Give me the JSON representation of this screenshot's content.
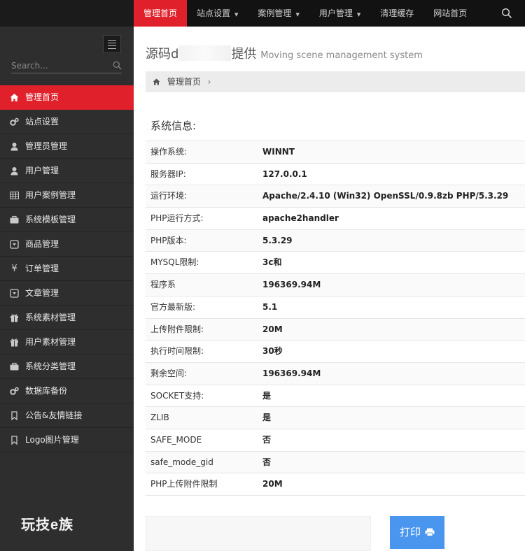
{
  "topnav": {
    "items": [
      {
        "label": "管理首页",
        "active": true,
        "dropdown": false
      },
      {
        "label": "站点设置",
        "active": false,
        "dropdown": true
      },
      {
        "label": "案例管理",
        "active": false,
        "dropdown": true
      },
      {
        "label": "用户管理",
        "active": false,
        "dropdown": true
      },
      {
        "label": "清理缓存",
        "active": false,
        "dropdown": false
      },
      {
        "label": "网站首页",
        "active": false,
        "dropdown": false
      }
    ],
    "search_icon": "search-icon"
  },
  "sidebar": {
    "search_placeholder": "Search...",
    "items": [
      {
        "label": "管理首页",
        "icon": "home-icon",
        "active": true
      },
      {
        "label": "站点设置",
        "icon": "cogs-icon"
      },
      {
        "label": "管理员管理",
        "icon": "user-icon"
      },
      {
        "label": "用户管理",
        "icon": "user-icon"
      },
      {
        "label": "用户案例管理",
        "icon": "table-icon"
      },
      {
        "label": "系统模板管理",
        "icon": "briefcase-icon"
      },
      {
        "label": "商品管理",
        "icon": "caret-square-icon"
      },
      {
        "label": "订单管理",
        "icon": "yen-icon"
      },
      {
        "label": "文章管理",
        "icon": "caret-square-icon"
      },
      {
        "label": "系统素材管理",
        "icon": "gift-icon"
      },
      {
        "label": "用户素材管理",
        "icon": "gift-icon"
      },
      {
        "label": "系统分类管理",
        "icon": "briefcase-icon"
      },
      {
        "label": "数据库备份",
        "icon": "cogs-icon"
      },
      {
        "label": "公告&友情链接",
        "icon": "bookmark-icon"
      },
      {
        "label": "Logo图片管理",
        "icon": "bookmark-icon"
      }
    ],
    "watermark": "玩技e族"
  },
  "main": {
    "title_part1": "源码d",
    "title_part2": "提供",
    "subtitle": "Moving scene management system",
    "breadcrumb": "管理首页",
    "section_title": "系统信息:",
    "info": [
      {
        "key": "操作系统:",
        "value": "WINNT"
      },
      {
        "key": "服务器IP:",
        "value": "127.0.0.1"
      },
      {
        "key": "运行环境:",
        "value": "Apache/2.4.10 (Win32) OpenSSL/0.9.8zb PHP/5.3.29"
      },
      {
        "key": "PHP运行方式:",
        "value": "apache2handler"
      },
      {
        "key": "PHP版本:",
        "value": "5.3.29"
      },
      {
        "key": "MYSQL限制:",
        "value": "3c和"
      },
      {
        "key": "程序系",
        "value": "196369.94M"
      },
      {
        "key": "官方最新版:",
        "value": "5.1"
      },
      {
        "key": "上传附件限制:",
        "value": "20M"
      },
      {
        "key": "执行时间限制:",
        "value": "30秒"
      },
      {
        "key": "剩余空间:",
        "value": "196369.94M"
      },
      {
        "key": "SOCKET支持:",
        "value": "是"
      },
      {
        "key": "ZLIB",
        "value": "是"
      },
      {
        "key": "SAFE_MODE",
        "value": "否"
      },
      {
        "key": "safe_mode_gid",
        "value": "否"
      },
      {
        "key": "PHP上传附件限制",
        "value": "20M"
      }
    ],
    "print_label": "打印"
  },
  "colors": {
    "accent": "#e0212b",
    "sidebar_bg": "#2e2e2e",
    "topnav_bg": "#121212",
    "print_button": "#4a96ee"
  }
}
